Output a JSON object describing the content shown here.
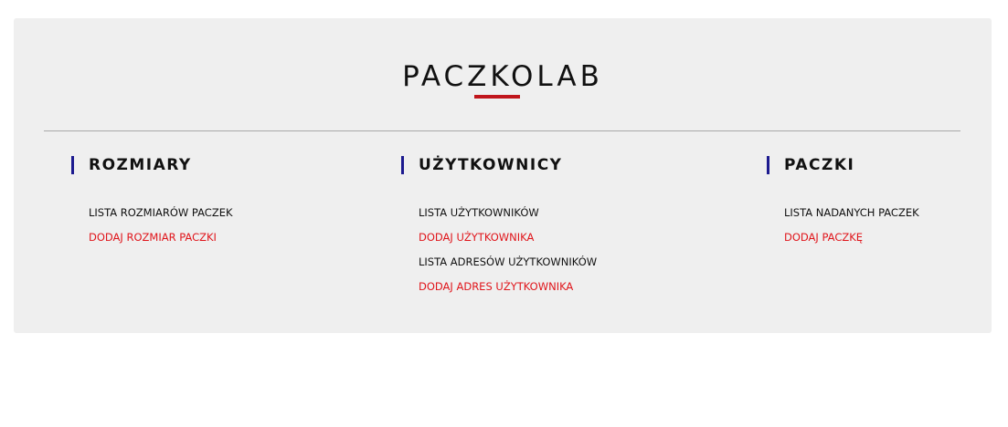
{
  "brand": {
    "name": "PACZKOLAB",
    "underline_color": "#c0161c"
  },
  "colors": {
    "panel_bg": "#efefef",
    "section_bar": "#1c1a8f",
    "link_default": "#111111",
    "link_add": "#e0151b"
  },
  "sections": [
    {
      "title": "ROZMIARY",
      "links": [
        {
          "label": "LISTA ROZMIARÓW PACZEK",
          "kind": "list"
        },
        {
          "label": "DODAJ ROZMIAR PACZKI",
          "kind": "add"
        }
      ]
    },
    {
      "title": "UŻYTKOWNICY",
      "links": [
        {
          "label": "LISTA UŻYTKOWNIKÓW",
          "kind": "list"
        },
        {
          "label": "DODAJ UŻYTKOWNIKA",
          "kind": "add"
        },
        {
          "label": "LISTA ADRESÓW UŻYTKOWNIKÓW",
          "kind": "list"
        },
        {
          "label": "DODAJ ADRES UŻYTKOWNIKA",
          "kind": "add"
        }
      ]
    },
    {
      "title": "PACZKI",
      "links": [
        {
          "label": "LISTA NADANYCH PACZEK",
          "kind": "list"
        },
        {
          "label": "DODAJ PACZKĘ",
          "kind": "add"
        }
      ]
    }
  ]
}
